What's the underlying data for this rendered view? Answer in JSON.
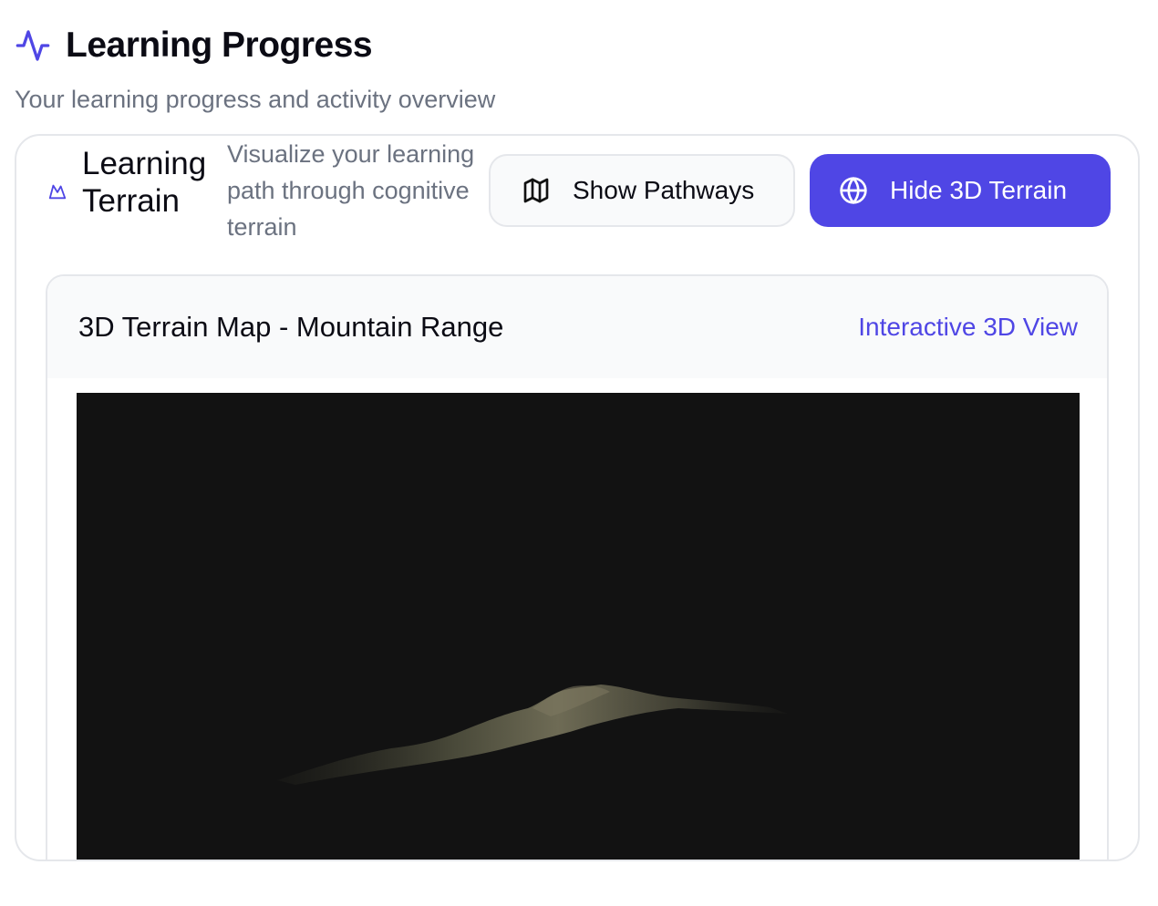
{
  "page": {
    "title": "Learning Progress",
    "subtitle": "Your learning progress and activity overview",
    "title_icon": "activity-icon",
    "accent_color": "#4f46e5"
  },
  "terrain_card": {
    "title": "Learning Terrain",
    "description": "Visualize your learning path through cognitive terrain",
    "icon": "mountain-icon",
    "buttons": {
      "show_pathways": {
        "label": "Show Pathways",
        "icon": "map-icon"
      },
      "hide_terrain": {
        "label": "Hide 3D Terrain",
        "icon": "globe-icon"
      }
    },
    "panel": {
      "title": "3D Terrain Map - Mountain Range",
      "view_link": "Interactive 3D View",
      "canvas_background": "#121212"
    }
  }
}
